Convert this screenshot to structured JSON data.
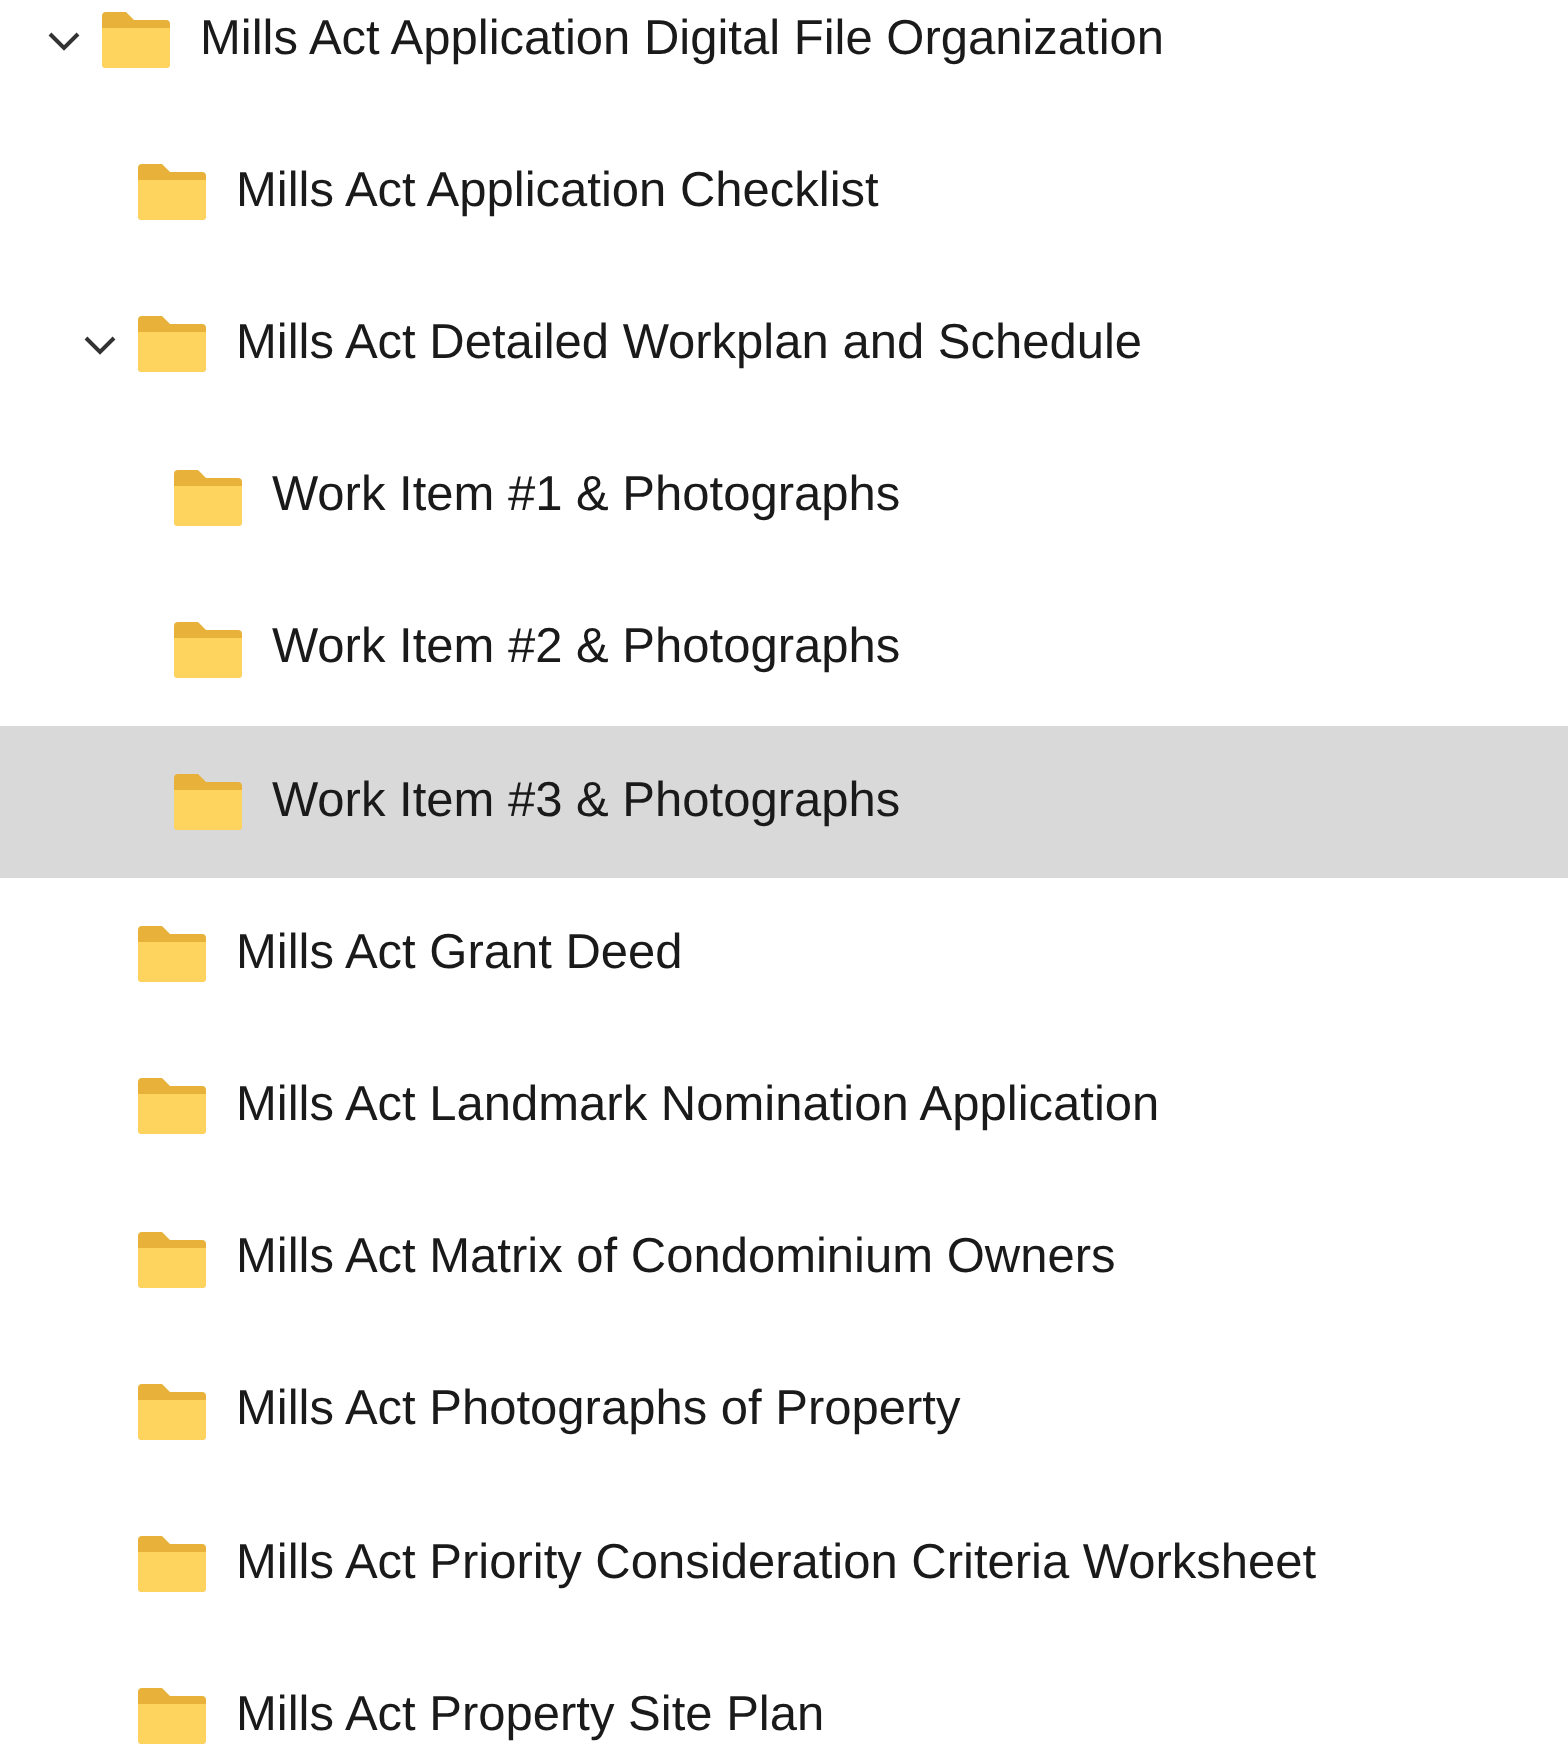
{
  "tree": [
    {
      "label": "Mills Act Application Digital File Organization",
      "selected": false,
      "expanded": true,
      "children": [
        {
          "label": "Mills Act Application Checklist",
          "selected": false
        },
        {
          "label": "Mills Act Detailed Workplan and Schedule",
          "selected": false,
          "expanded": true,
          "children": [
            {
              "label": "Work Item #1 & Photographs",
              "selected": false
            },
            {
              "label": "Work Item #2 & Photographs",
              "selected": false
            },
            {
              "label": "Work Item #3 & Photographs",
              "selected": true
            }
          ]
        },
        {
          "label": "Mills Act Grant Deed",
          "selected": false
        },
        {
          "label": "Mills Act Landmark Nomination Application",
          "selected": false
        },
        {
          "label": "Mills Act Matrix of Condominium Owners",
          "selected": false
        },
        {
          "label": "Mills Act Photographs of Property",
          "selected": false
        },
        {
          "label": "Mills Act Priority Consideration Criteria Worksheet",
          "selected": false
        },
        {
          "label": "Mills Act Property Site Plan",
          "selected": false
        }
      ]
    }
  ]
}
